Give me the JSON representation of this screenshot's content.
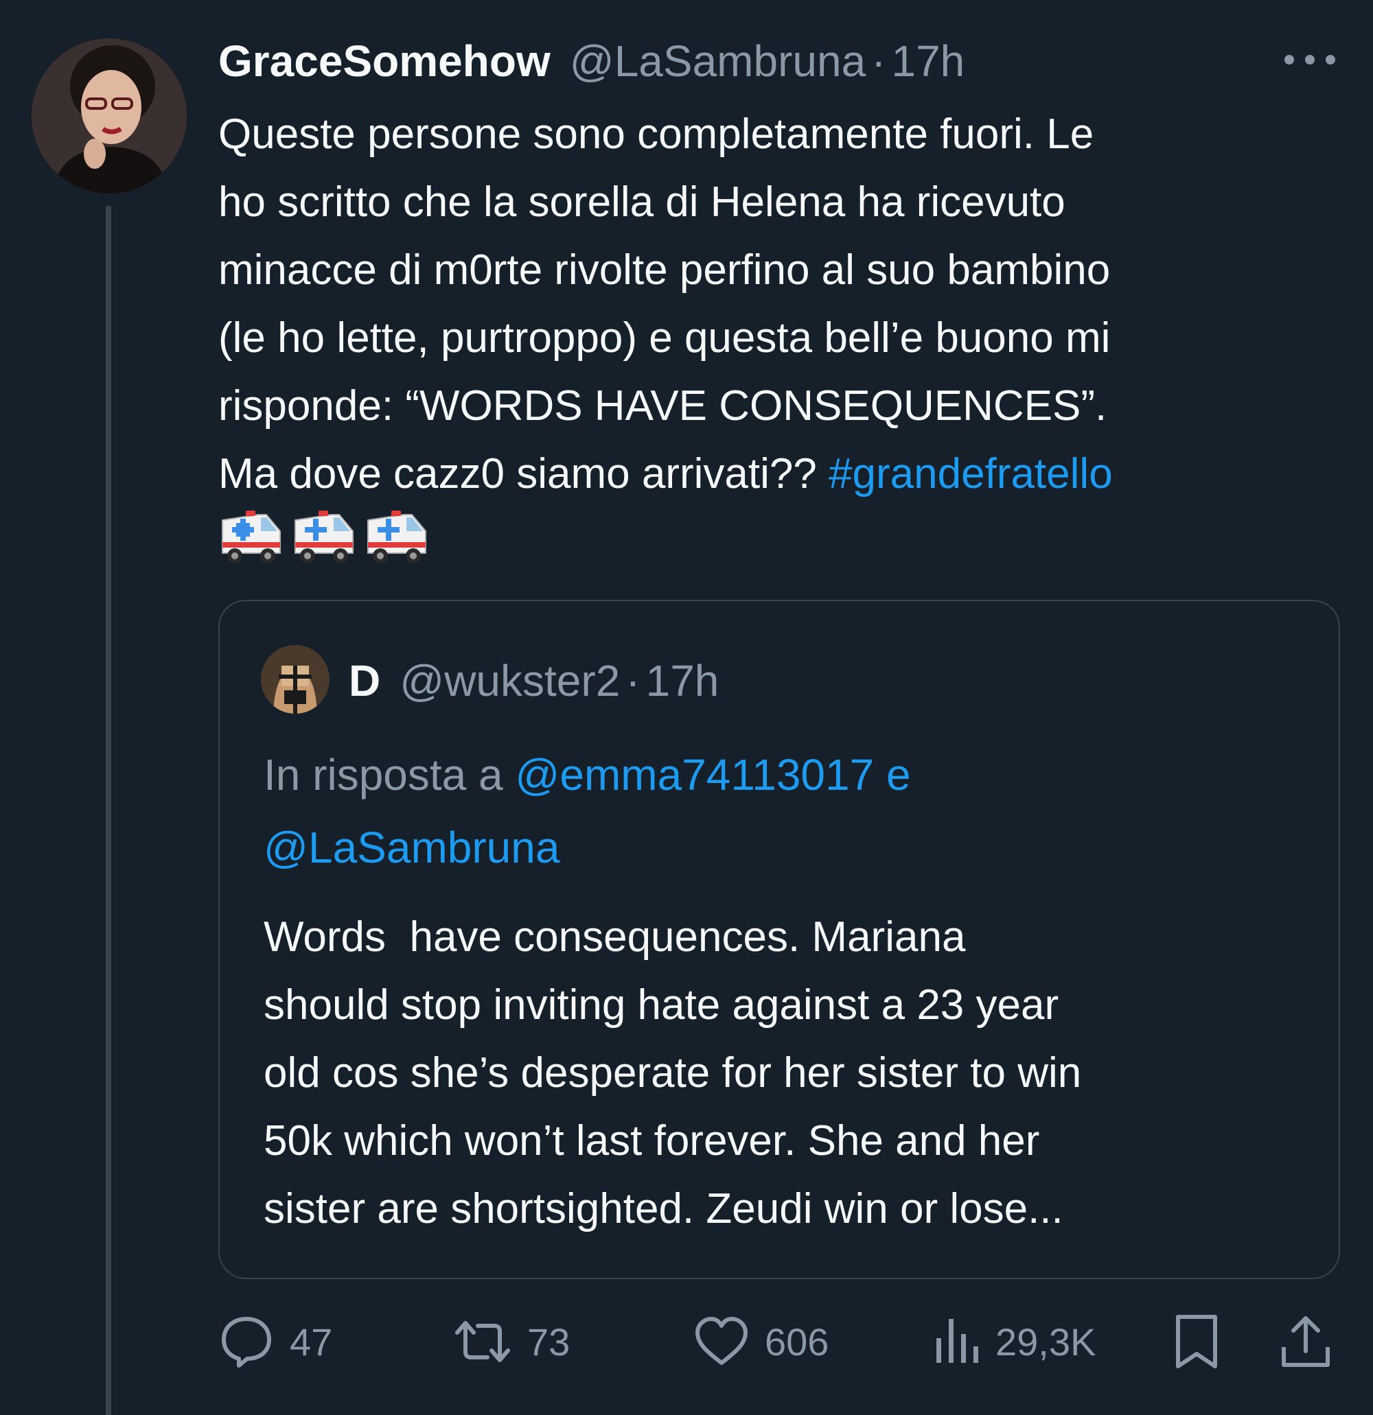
{
  "tweet": {
    "display_name": "GraceSomehow",
    "handle": "@LaSambruna",
    "separator": "·",
    "time": "17h",
    "text_lines": [
      "Queste persone sono completamente fuori. Le",
      "ho scritto che la sorella di Helena ha ricevuto",
      "minacce di m0rte rivolte perfino al suo bambino",
      "(le ho lette, purtroppo) e questa bell’e buono mi",
      "risponde: “WORDS HAVE CONSEQUENCES”."
    ],
    "last_line_text": "Ma dove cazz0 siamo arrivati?? ",
    "hashtag": "#grandefratello",
    "emojis": [
      "ambulance-emoji",
      "ambulance-emoji",
      "ambulance-emoji"
    ]
  },
  "quote": {
    "display_name": "D",
    "handle": "@wukster2",
    "separator": "·",
    "time": "17h",
    "reply_prefix": "In risposta a ",
    "reply_mention_1": "@emma74113017",
    "reply_joiner": " e",
    "reply_mention_2": "@LaSambruna",
    "text_lines": [
      "Words  have consequences. Mariana",
      "should stop inviting hate against a 23 year",
      "old cos she’s desperate for her sister to win",
      "50k which won’t last forever. She and her",
      "sister are shortsighted. Zeudi win or lose..."
    ]
  },
  "actions": {
    "replies": "47",
    "retweets": "73",
    "likes": "606",
    "views": "29,3K"
  },
  "colors": {
    "background": "#15202b",
    "text": "#f7f9f9",
    "secondary": "#8b98a5",
    "link": "#1d9bf0",
    "border": "#38444d"
  }
}
